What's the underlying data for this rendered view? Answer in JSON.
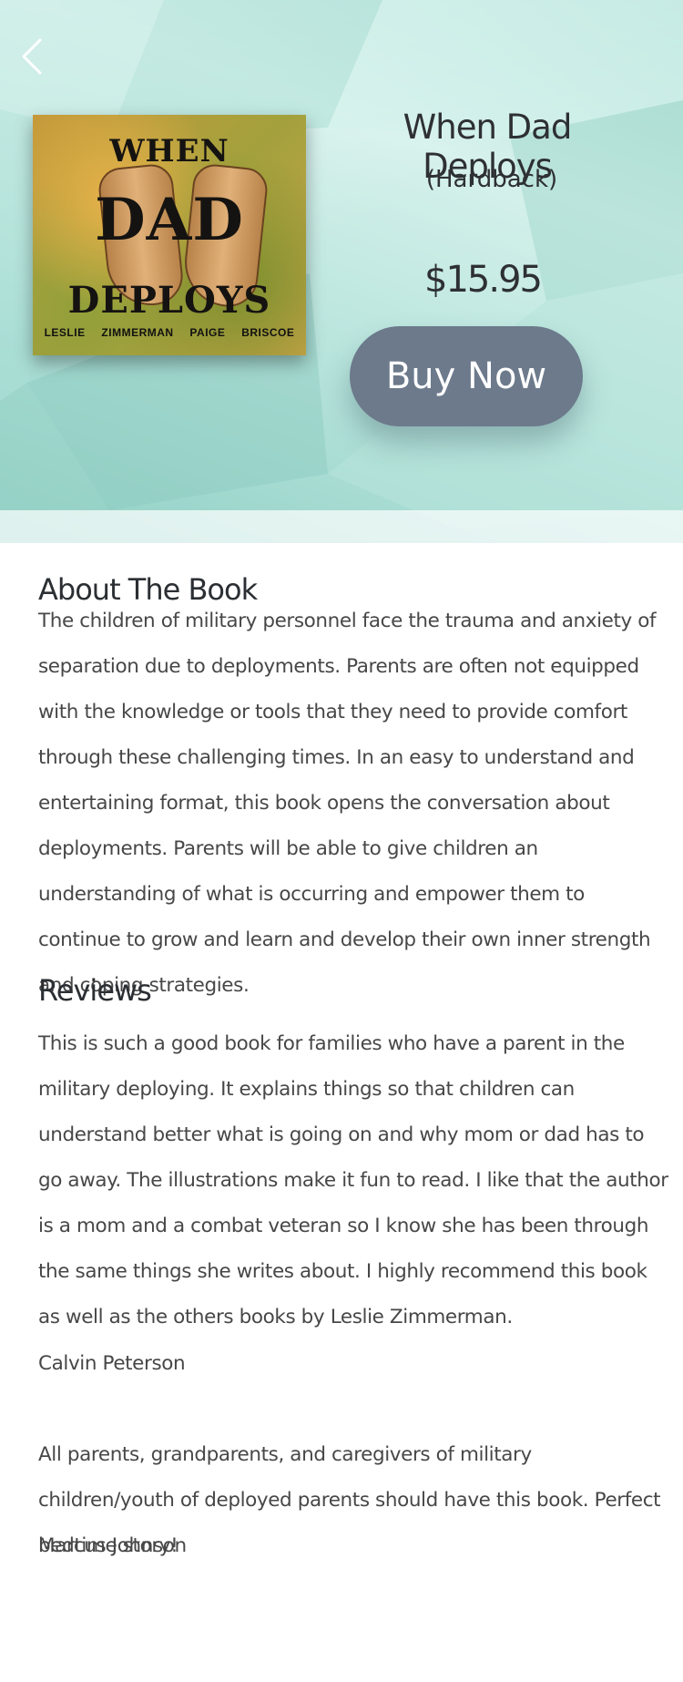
{
  "product": {
    "title": "When Dad Deploys",
    "format": "(Hardback)",
    "price": "$15.95",
    "buy_label": "Buy Now"
  },
  "cover": {
    "line1": "WHEN",
    "line2": "DAD",
    "line3": "DEPLOYS",
    "authors": "LESLIE ZIMMERMAN PAIGE BRISCOE"
  },
  "about": {
    "heading": "About The Book",
    "text": "The children of military personnel face the trauma and anxiety of separation due to deployments. Parents are often not equipped with the knowledge or tools that they need to provide comfort through these challenging times. In an easy to understand and entertaining format, this book opens the conversation about deployments. Parents will be able to give children an understanding of what is occurring and empower them to continue to grow and learn and develop their own inner strength and coping strategies."
  },
  "reviews": {
    "heading": "Reviews",
    "items": [
      {
        "text": "This is such a good book for families who have a parent in the military deploying. It explains things so that children can understand better what is going on and why mom or dad has to go away. The illustrations make it fun to read. I like that the author is a mom and a combat veteran so I know she has been through the same things she writes about. I highly recommend this book as well as the others books by Leslie Zimmerman.",
        "author": "Calvin Peterson"
      },
      {
        "text": "All parents, grandparents, and caregivers of military children/youth of deployed parents should have this book. Perfect bedtime story!",
        "author": "Marcus Johnson"
      }
    ]
  },
  "icons": {
    "back": "chevron-left-icon"
  },
  "colors": {
    "buy_button": "#6c7a8c",
    "hero_background": "#b9e5dd",
    "heading_text": "#2b2f33",
    "body_text": "#474747"
  }
}
